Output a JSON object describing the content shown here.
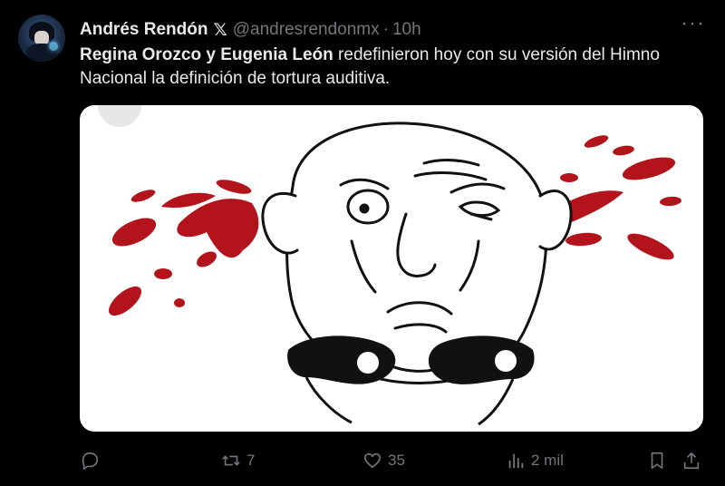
{
  "post": {
    "author_name": "Andrés Rendón",
    "x_mark": "𝕏",
    "handle": "@andresrendonmx",
    "separator": "·",
    "time": "10h",
    "text_bold": "Regina Orozco y Eugenia León",
    "text_rest": " redefinieron hoy con su versión del Himno Nacional la definición de tortura auditiva."
  },
  "actions": {
    "reply_count": "",
    "repost_count": "7",
    "like_count": "35",
    "views_count": "2 mil"
  },
  "colors": {
    "background": "#000000",
    "text": "#e7e9ea",
    "muted": "#71767b",
    "blood": "#b3141c"
  },
  "icons": [
    "reply-icon",
    "repost-icon",
    "like-icon",
    "views-icon",
    "bookmark-icon",
    "share-icon",
    "more-icon"
  ]
}
